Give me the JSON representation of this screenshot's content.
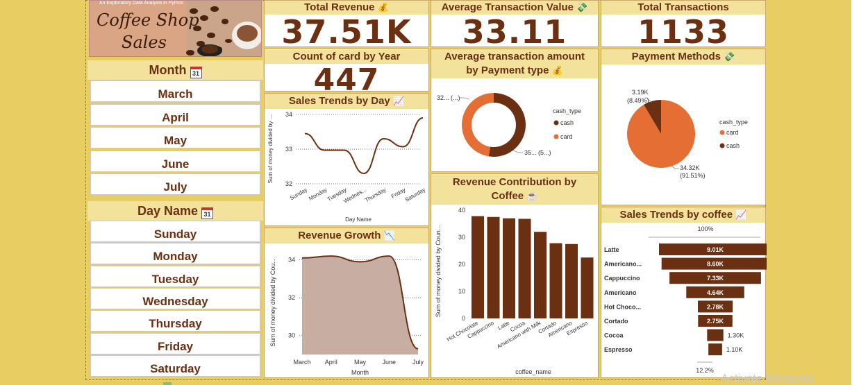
{
  "banner": {
    "tagline": "An Exploratory Data Analysis in Python",
    "line1": "Coffee Shop",
    "line2": "Sales"
  },
  "month_slicer": {
    "title": "Month",
    "items": [
      "March",
      "April",
      "May",
      "June",
      "July"
    ]
  },
  "day_slicer": {
    "title": "Day Name",
    "items": [
      "Sunday",
      "Monday",
      "Tuesday",
      "Wednesday",
      "Thursday",
      "Friday",
      "Saturday"
    ]
  },
  "kpis": {
    "total_revenue": {
      "title": "Total Revenue",
      "value": "37.51K"
    },
    "avg_transaction": {
      "title": "Average Transaction Value",
      "value": "33.11"
    },
    "total_transactions": {
      "title": "Total Transactions",
      "value": "1133"
    },
    "count_card": {
      "title": "Count of card by Year",
      "value": "447"
    }
  },
  "icons": {
    "money": "money-bag-icon",
    "calendar": "calendar-icon",
    "chart": "chart-up-icon",
    "cash": "cash-icon",
    "coffee": "coffee-cup-icon"
  },
  "colors": {
    "brown": "#6b2f12",
    "orange": "#E46E33",
    "gold": "#E8CE62",
    "title_bg": "#F2E29C",
    "area": "#C8ADA2"
  },
  "charts": {
    "sales_by_day": {
      "title": "Sales Trends by Day",
      "ylabel": "Sum of money divided by ...",
      "xlabel": "Day Name",
      "ticks_y": [
        "34",
        "33",
        "32"
      ],
      "ticks_x": [
        "Sunday",
        "Monday",
        "Tuesday",
        "Wednes...",
        "Thursday",
        "Friday",
        "Saturday"
      ]
    },
    "revenue_growth": {
      "title": "Revenue Growth",
      "ylabel": "Sum of money divided by Cou...",
      "xlabel": "Month",
      "ticks_y": [
        "34",
        "32",
        "30"
      ],
      "ticks_x": [
        "March",
        "April",
        "May",
        "June",
        "July"
      ]
    },
    "avg_by_payment": {
      "title1": "Average transaction amount",
      "title2": "by Payment type",
      "legend_title": "cash_type",
      "legend": [
        "cash",
        "card"
      ],
      "label_card": "32... (...)",
      "label_cash": "35... (5...)"
    },
    "revenue_by_coffee": {
      "title1": "Revenue Contribution by",
      "title2": "Coffee",
      "ylabel": "Sum of money divided by Coun...",
      "xlabel": "coffee_name",
      "ticks_y": [
        "40",
        "30",
        "20",
        "10",
        "0"
      ],
      "ticks_x": [
        "Hot Chocolate",
        "Cappuccino",
        "Latte",
        "Cocoa",
        "Americano with Milk",
        "Cortado",
        "Americano",
        "Espresso"
      ]
    },
    "payment_methods": {
      "title": "Payment Methods",
      "legend_title": "cash_type",
      "legend": [
        "card",
        "cash"
      ],
      "label_cash_1": "3.19K",
      "label_cash_2": "(8.49%)",
      "label_card_1": "34.32K",
      "label_card_2": "(91.51%)"
    },
    "sales_by_coffee": {
      "title": "Sales Trends by coffee",
      "top_label": "100%",
      "bottom_label": "12.2%",
      "categories": [
        "Latte",
        "Americano...",
        "Cappuccino",
        "Americano",
        "Hot Choco...",
        "Cortado",
        "Cocoa",
        "Espresso"
      ],
      "value_labels": [
        "9.01K",
        "8.60K",
        "7.33K",
        "4.64K",
        "2.78K",
        "2.75K",
        "1.30K",
        "1.10K"
      ]
    }
  },
  "chart_data": [
    {
      "type": "line",
      "title": "Sales Trends by Day",
      "xlabel": "Day Name",
      "ylabel": "Sum of money divided by ...",
      "categories": [
        "Sunday",
        "Monday",
        "Tuesday",
        "Wednes...",
        "Thursday",
        "Friday",
        "Saturday"
      ],
      "values": [
        33.45,
        32.97,
        32.97,
        32.3,
        33.3,
        33.07,
        33.9
      ],
      "ylim": [
        32,
        34
      ],
      "grid": true
    },
    {
      "type": "area",
      "title": "Revenue Growth",
      "xlabel": "Month",
      "ylabel": "Sum of money divided by Cou...",
      "categories": [
        "March",
        "April",
        "May",
        "June",
        "July"
      ],
      "values": [
        34.1,
        34.2,
        33.9,
        34.2,
        29.3
      ],
      "ylim": [
        29,
        34.5
      ],
      "grid": true
    },
    {
      "type": "pie",
      "title": "Average transaction amount by Payment type",
      "labels": [
        "cash",
        "card"
      ],
      "values": [
        52.5,
        47.5
      ],
      "donut": true
    },
    {
      "type": "bar",
      "title": "Revenue Contribution by Coffee",
      "xlabel": "coffee_name",
      "ylabel": "Sum of money divided by Coun...",
      "categories": [
        "Hot Chocolate",
        "Cappuccino",
        "Latte",
        "Cocoa",
        "Americano with Milk",
        "Cortado",
        "Americano",
        "Espresso"
      ],
      "values": [
        37.8,
        37.5,
        37.0,
        36.8,
        32.0,
        27.8,
        27.5,
        22.5
      ],
      "ylim": [
        0,
        40
      ]
    },
    {
      "type": "pie",
      "title": "Payment Methods",
      "labels": [
        "card",
        "cash"
      ],
      "values": [
        34.32,
        3.19
      ],
      "percent": [
        91.51,
        8.49
      ]
    },
    {
      "type": "bar",
      "title": "Sales Trends by coffee",
      "orientation": "funnel",
      "categories": [
        "Latte",
        "Americano...",
        "Cappuccino",
        "Americano",
        "Hot Choco...",
        "Cortado",
        "Cocoa",
        "Espresso"
      ],
      "values": [
        9.01,
        8.6,
        7.33,
        4.64,
        2.78,
        2.75,
        1.3,
        1.1
      ]
    }
  ]
}
